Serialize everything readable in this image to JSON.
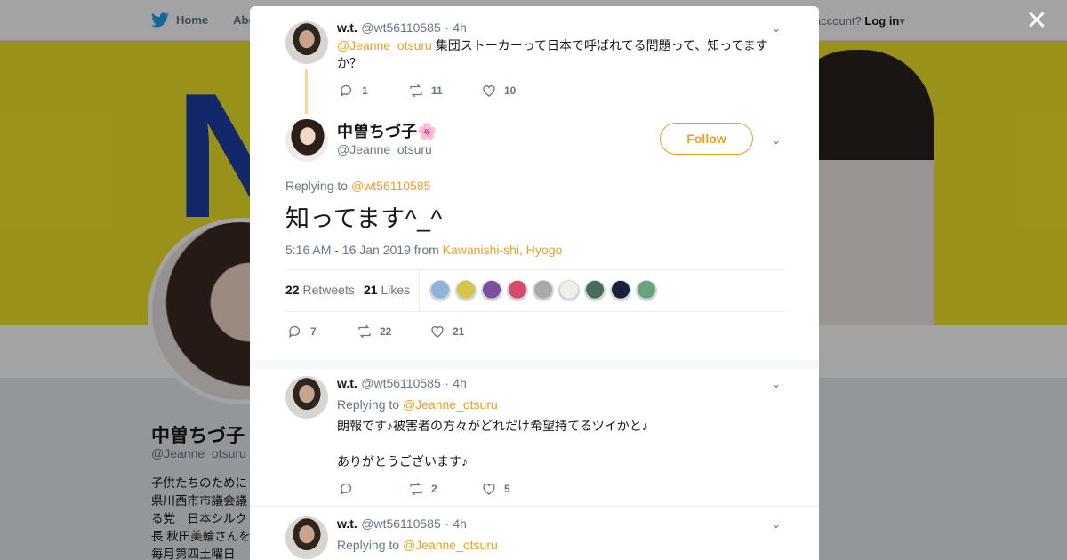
{
  "background": {
    "nav": {
      "home": "Home",
      "about": "Abo"
    },
    "login": {
      "prefix": "account?",
      "action": "Log in"
    },
    "banner_letter": "N",
    "profile": {
      "name": "中曽ちづ子",
      "handle": "@Jeanne_otsuru",
      "bio_lines": [
        "子供たちのために",
        "県川西市市議会議",
        "る党　日本シルク",
        "長 秋田美輪さんを",
        "毎月第四土曜日"
      ]
    }
  },
  "close_icon": "close-icon",
  "parent_tweet": {
    "name": "w.t.",
    "handle": "@wt56110585",
    "dot": "·",
    "time": "4h",
    "mention": "@Jeanne_otsuru",
    "text_line1": " 集団ストーカーって日本で呼ばれてる問題って、知ってます",
    "text_line2": "か？",
    "replies": "1",
    "retweets": "11",
    "likes": "10"
  },
  "main_tweet": {
    "name": "中曽ちづ子",
    "emoji": "🌸",
    "handle": "@Jeanne_otsuru",
    "follow_label": "Follow",
    "replying_label": "Replying to",
    "replying_to": "@wt56110585",
    "text": "知ってます^_^",
    "timestamp": "5:16 AM - 16 Jan 2019",
    "from_label": "from",
    "location": "Kawanishi-shi, Hyogo",
    "retweet_count": "22",
    "retweet_label": "Retweets",
    "like_count": "21",
    "like_label": "Likes",
    "likers": [
      "#8fb3d9",
      "#d9c24a",
      "#7a4fa0",
      "#d94a6a",
      "#a9aaa5",
      "#f0eee8",
      "#4a6a5a",
      "#1a1f3a",
      "#6aa37a"
    ],
    "replies": "7",
    "retweets": "22",
    "likes": "21"
  },
  "reply1": {
    "name": "w.t.",
    "handle": "@wt56110585",
    "dot": "·",
    "time": "4h",
    "replying_label": "Replying to",
    "replying_to": "@Jeanne_otsuru",
    "line1": "朗報です♪被害者の方々がどれだけ希望持てるツイかと♪",
    "line2": "ありがとうございます♪",
    "replies": "",
    "retweets": "2",
    "likes": "5"
  },
  "reply2": {
    "name": "w.t.",
    "handle": "@wt56110585",
    "dot": "·",
    "time": "4h",
    "replying_label": "Replying to",
    "replying_to": "@Jeanne_otsuru"
  },
  "colors": {
    "accent": "#e8a023",
    "text": "#14171a",
    "muted": "#657786",
    "banner": "#f0e52a"
  }
}
